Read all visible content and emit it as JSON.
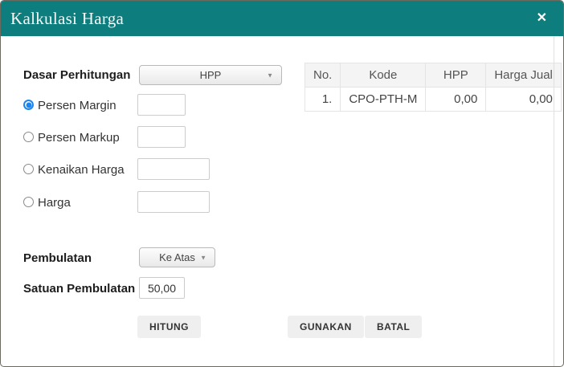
{
  "window": {
    "title": "Kalkulasi Harga",
    "close_icon": "✕"
  },
  "colors": {
    "header_bg": "#0d7d7d",
    "radio_selected": "#1d86ee",
    "table_header_bg": "#f4f4f4"
  },
  "form": {
    "dasar_label": "Dasar Perhitungan",
    "dasar_value": "HPP",
    "chevron_icon": "▼",
    "options": [
      {
        "label": "Persen Margin",
        "selected": true,
        "value": ""
      },
      {
        "label": "Persen Markup",
        "selected": false,
        "value": ""
      },
      {
        "label": "Kenaikan Harga",
        "selected": false,
        "value": ""
      },
      {
        "label": "Harga",
        "selected": false,
        "value": ""
      }
    ],
    "pembulatan_label": "Pembulatan",
    "pembulatan_value": "Ke Atas",
    "satuan_label": "Satuan Pembulatan",
    "satuan_value": "50,00"
  },
  "buttons": {
    "hitung": "HITUNG",
    "gunakan": "GUNAKAN",
    "batal": "BATAL"
  },
  "table": {
    "headers": [
      "No.",
      "Kode",
      "HPP",
      "Harga Jual"
    ],
    "rows": [
      {
        "no": "1.",
        "kode": "CPO-PTH-M",
        "hpp": "0,00",
        "harga_jual": "0,00"
      }
    ]
  }
}
